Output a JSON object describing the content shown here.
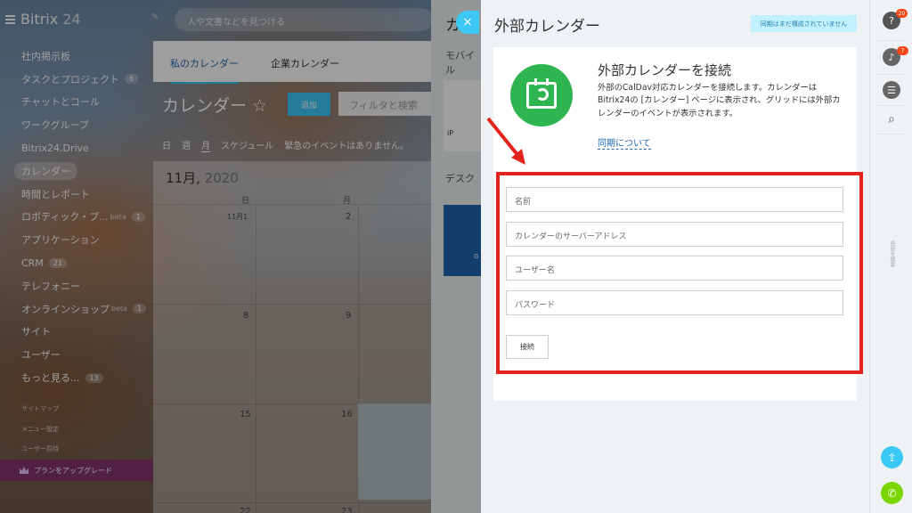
{
  "app": {
    "logo_name": "Bitrix",
    "logo_number": "24"
  },
  "search": {
    "placeholder": "人や文書などを見つける"
  },
  "sidebar": {
    "items": [
      {
        "label": "社内掲示板"
      },
      {
        "label": "タスクとプロジェクト",
        "count": "6"
      },
      {
        "label": "チャットとコール"
      },
      {
        "label": "ワークグループ"
      },
      {
        "label": "Bitrix24.Drive"
      },
      {
        "label": "カレンダー",
        "active": true
      },
      {
        "label": "時間とレポート"
      },
      {
        "label": "ロボティック・プ...",
        "beta": "beta",
        "count": "1"
      },
      {
        "label": "アプリケーション"
      },
      {
        "label": "CRM",
        "count": "21"
      },
      {
        "label": "テレフォニー"
      },
      {
        "label": "オンラインショップ",
        "beta": "beta",
        "count": "1"
      },
      {
        "label": "サイト"
      },
      {
        "label": "ユーザー"
      },
      {
        "label": "もっと見る...",
        "count": "13"
      }
    ],
    "sitemap": "サイトマップ",
    "menu_settings": "メニュー設定",
    "invite": "ユーザー招待",
    "upgrade": "プランをアップグレード"
  },
  "calendar": {
    "tab_my": "私のカレンダー",
    "tab_company": "企業カレンダー",
    "title": "カレンダー ☆",
    "add_label": "追加",
    "filter_placeholder": "フィルタと検索",
    "views": {
      "day": "日",
      "week": "週",
      "month": "月",
      "schedule": "スケジュール",
      "no_events": "緊急のイベントはありません。"
    },
    "month_label": "11月,",
    "year_label": "2020",
    "day_headers": {
      "sun": "日",
      "mon": "月"
    },
    "dates": {
      "d1": "11月1",
      "d2": "2",
      "d8": "8",
      "d9": "9",
      "d15": "15",
      "d16": "16",
      "d22": "22",
      "d23": "23"
    }
  },
  "slider2": {
    "title": "カ",
    "mobile": "モバイル",
    "desktop": "デスク",
    "card_text": "iP",
    "blue_text": "G"
  },
  "panel": {
    "close": "×",
    "title": "外部カレンダー",
    "status_badge": "同期はまだ構成されていません",
    "heading": "外部カレンダーを接続",
    "description": "外部のCalDav対応カレンダーを接続します。カレンダーはBitrix24の [カレンダー] ページに表示され、グリッドには外部カレンダーのイベントが表示されます。",
    "sync_link": "同期について",
    "fields": {
      "name_placeholder": "名前",
      "server_placeholder": "カレンダーのサーバーアドレス",
      "user_placeholder": "ユーザー名",
      "password_placeholder": "パスワード"
    },
    "connect": "接続"
  },
  "rightbar": {
    "help_count": "20",
    "notify_count": "7",
    "vertical_text": "会話を検索"
  },
  "colors": {
    "accent": "#3bc8f5",
    "highlight": "#e4231c",
    "green": "#2fb550",
    "link": "#2067b0"
  }
}
